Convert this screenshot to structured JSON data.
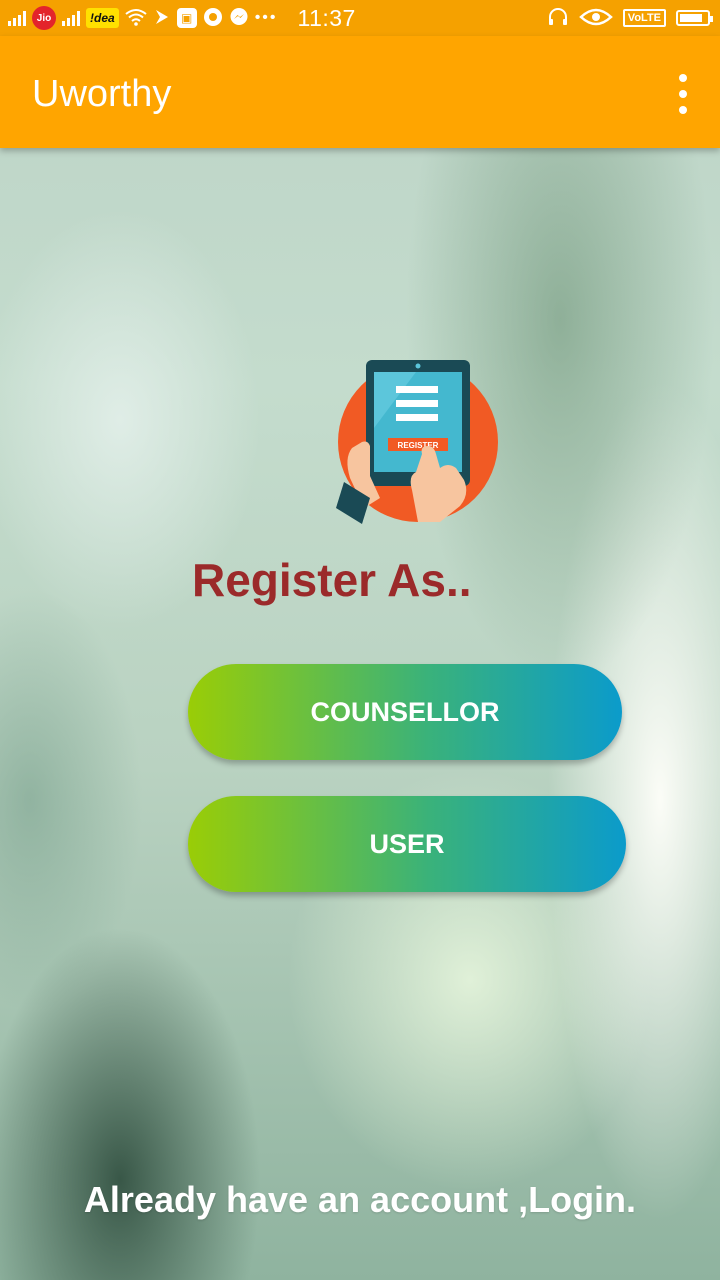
{
  "status_bar": {
    "carrier1": "Jio",
    "carrier2": "!dea",
    "time": "11:37",
    "volte": "VoLTE",
    "battery_level": 0.85,
    "icons": [
      "signal-icon",
      "jio-icon",
      "signal-icon",
      "idea-icon",
      "wifi-icon",
      "flag-icon",
      "android-icon",
      "chrome-icon",
      "messenger-icon",
      "more-dots-icon",
      "headset-icon",
      "eye-icon",
      "volte-icon",
      "battery-icon"
    ]
  },
  "app_bar": {
    "title": "Uworthy",
    "menu_icon": "more-vert-icon"
  },
  "logo": {
    "icon": "register-tablet-icon",
    "label": "REGISTER"
  },
  "main": {
    "heading": "Register As..",
    "counsellor_button": "COUNSELLOR",
    "user_button": "USER",
    "login_link": "Already have an account ,Login."
  },
  "colors": {
    "status_bar": "#f5a100",
    "app_bar": "#ffa500",
    "heading": "#9b2a2a",
    "button_start": "#9acd06",
    "button_end": "#0b9bcb"
  }
}
